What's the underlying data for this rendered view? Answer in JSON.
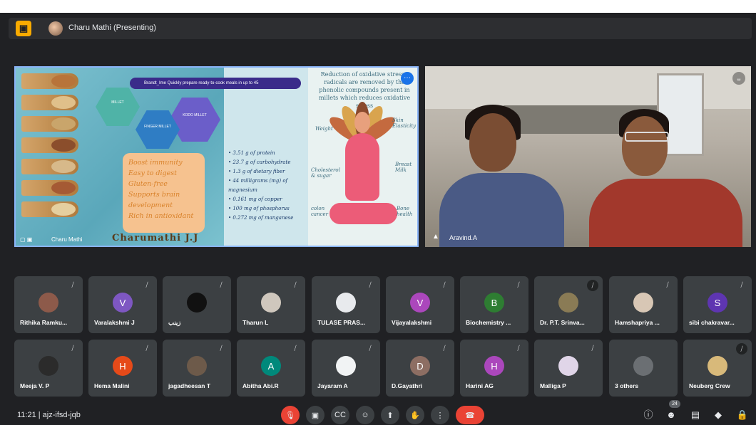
{
  "presenter": {
    "name": "Charu Mathi (Presenting)",
    "logo": "▣"
  },
  "share": {
    "label": "Charu Mathi",
    "banner": "Brandt_Ime  Quickly prepare ready-to-cook meals in up to 45",
    "slide_title": "Charumathi J.J",
    "benefits": [
      "Boost immunity",
      "Easy to digest",
      "Gluten-free",
      "Supports brain",
      "development",
      "Rich in antioxidant"
    ],
    "nutrition": [
      "• 3.51 g of protein",
      "• 23.7 g of carbohydrate",
      "• 1.3 g of dietary fiber",
      "• 44 milligrams (mg) of",
      "magnesium",
      "• 0.161 mg of copper",
      "• 100 mg of phosphorus",
      "• 0.272 mg of manganese"
    ],
    "oxidative": "Reduction of oxidative stress - radicals are removed by the phenolic compounds present in millets which reduces oxidative stress",
    "tags": [
      "Weight",
      "Skin Elasticity",
      "Cholesterol & sugar",
      "Breast Milk",
      "colon cancer",
      "Bone health"
    ],
    "hex_labels": [
      "MILLET",
      "FINGER MILLET",
      "KODO MILLET"
    ]
  },
  "camera": {
    "label": "Aravind.A"
  },
  "participants": [
    {
      "name": "Rithika Ramku...",
      "initial": "",
      "color": "#8d5a4a"
    },
    {
      "name": "Varalakshmi J",
      "initial": "V",
      "color": "#7e57c2"
    },
    {
      "name": "زینب",
      "initial": "",
      "color": "#111111"
    },
    {
      "name": "Tharun L",
      "initial": "",
      "color": "#cfc7bd"
    },
    {
      "name": "TULASE PRAS...",
      "initial": "",
      "color": "#e8eaed"
    },
    {
      "name": "Vijayalakshmi",
      "initial": "V",
      "color": "#ab47bc"
    },
    {
      "name": "Biochemistry ...",
      "initial": "B",
      "color": "#2e7d32"
    },
    {
      "name": "Dr. P.T. Srinva...",
      "initial": "",
      "color": "#8a7b55"
    },
    {
      "name": "Hamshapriya ...",
      "initial": "",
      "color": "#d8c7b5"
    },
    {
      "name": "sibi chakravar...",
      "initial": "S",
      "color": "#5e35b1"
    },
    {
      "name": "Meeja V. P",
      "initial": "",
      "color": "#2b2b2b"
    },
    {
      "name": "Hema Malini",
      "initial": "H",
      "color": "#e64a19"
    },
    {
      "name": "jagadheesan T",
      "initial": "",
      "color": "#6d5a4a"
    },
    {
      "name": "Abitha Abi.R",
      "initial": "A",
      "color": "#00897b"
    },
    {
      "name": "Jayaram A",
      "initial": "",
      "color": "#f1f3f4"
    },
    {
      "name": "D.Gayathri",
      "initial": "D",
      "color": "#8d6e63"
    },
    {
      "name": "Harini AG",
      "initial": "H",
      "color": "#ab47bc"
    },
    {
      "name": "Malliga P",
      "initial": "",
      "color": "#e0d5e8"
    },
    {
      "name": "3 others",
      "initial": "",
      "color": "#6b6f73"
    },
    {
      "name": "Neuberg Crew",
      "initial": "",
      "color": "#d8b97a"
    }
  ],
  "bottom": {
    "time_code": "11:21  |  ajz-ifsd-jqb",
    "people_count": "24",
    "icons": [
      "mic-off-icon",
      "camera-icon",
      "captions-icon",
      "emoji-icon",
      "present-icon",
      "hand-icon",
      "more-icon",
      "end-call-icon"
    ]
  },
  "colors": {
    "accent": "#8ab4f8",
    "danger": "#ea4335",
    "tile": "#3c4043",
    "bg": "#202124"
  }
}
